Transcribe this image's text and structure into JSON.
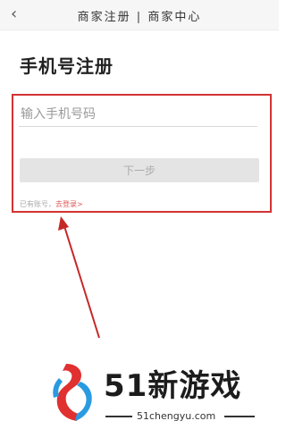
{
  "header": {
    "back_glyph": "‹",
    "title": "商家注册 | 商家中心"
  },
  "page": {
    "heading": "手机号注册"
  },
  "form": {
    "phone_placeholder": "输入手机号码",
    "next_label": "下一步",
    "login_prompt": "已有账号，",
    "login_link": "去登录>"
  },
  "watermark": {
    "brand": "51新游戏",
    "url": "51chengyu.com"
  },
  "colors": {
    "highlight": "#d23333",
    "link": "#e05555",
    "logo_red": "#e03030",
    "logo_blue": "#2a9be0"
  }
}
